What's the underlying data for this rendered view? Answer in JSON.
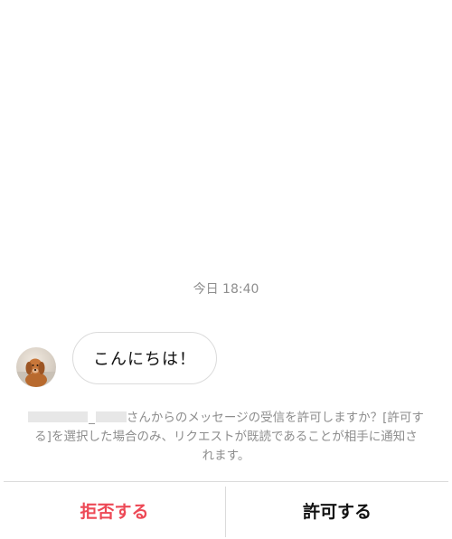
{
  "conversation": {
    "timestamp": "今日 18:40",
    "message": "こんにちは！"
  },
  "sender": {
    "avatar_icon": "dog-avatar-icon",
    "name_separator": "_"
  },
  "request": {
    "line1_text": "さんからのメッセージの受信を許可しますか？[許可す",
    "line2_text": "る]を選択した場合のみ、リクエストが既読であることが相手に通知さ",
    "line3_text": "れます。"
  },
  "actions": {
    "decline_label": "拒否する",
    "accept_label": "許可する"
  },
  "colors": {
    "decline": "#ed4956",
    "accept": "#111111",
    "muted_text": "#8e8e8e",
    "border": "#dbdbdb"
  }
}
